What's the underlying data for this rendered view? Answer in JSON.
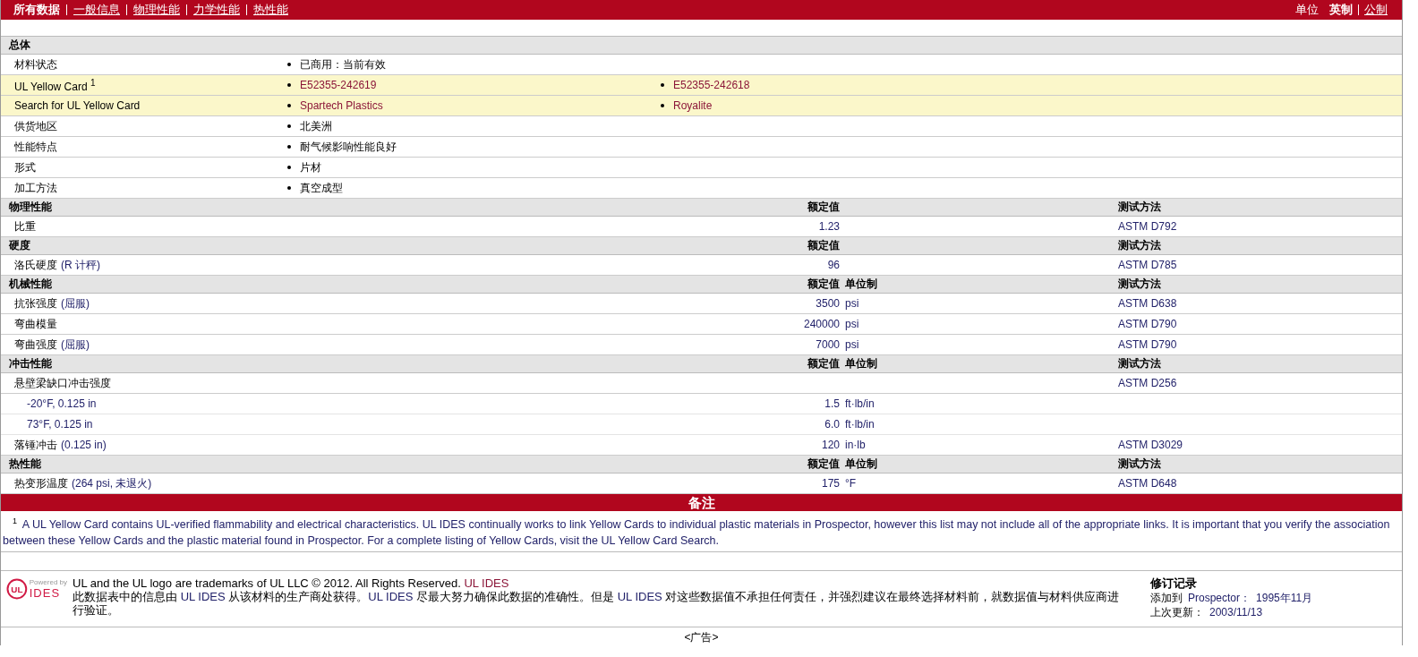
{
  "nav": {
    "items": [
      {
        "label": "所有数据",
        "selected": true
      },
      {
        "label": "一般信息",
        "selected": false
      },
      {
        "label": "物理性能",
        "selected": false
      },
      {
        "label": "力学性能",
        "selected": false
      },
      {
        "label": "热性能",
        "selected": false
      }
    ],
    "units": {
      "label": "单位",
      "options": [
        {
          "label": "英制",
          "selected": true
        },
        {
          "label": "公制",
          "selected": false
        }
      ]
    }
  },
  "general": {
    "title": "总体",
    "rows": [
      {
        "label": "材料状态",
        "highlighted": false,
        "values": [
          {
            "text": "已商用：当前有效",
            "kind": "text"
          }
        ]
      },
      {
        "label": "UL Yellow Card $^{1}$",
        "highlighted": true,
        "values": [
          {
            "text": "E52355-242619",
            "kind": "link"
          },
          {
            "text": "E52355-242618",
            "kind": "link"
          }
        ]
      },
      {
        "label": "Search for UL Yellow Card",
        "highlighted": true,
        "values": [
          {
            "text": "Spartech Plastics",
            "kind": "link"
          },
          {
            "text": "Royalite",
            "kind": "link"
          }
        ]
      },
      {
        "label": "供货地区",
        "highlighted": false,
        "values": [
          {
            "text": "北美洲",
            "kind": "text"
          }
        ]
      },
      {
        "label": "性能特点",
        "highlighted": false,
        "values": [
          {
            "text": "耐气候影响性能良好",
            "kind": "text"
          }
        ]
      },
      {
        "label": "形式",
        "highlighted": false,
        "values": [
          {
            "text": "片材",
            "kind": "text"
          }
        ]
      },
      {
        "label": "加工方法",
        "highlighted": false,
        "values": [
          {
            "text": "真空成型",
            "kind": "text"
          }
        ]
      }
    ]
  },
  "sections": [
    {
      "title": "物理性能",
      "header": {
        "value": "额定值",
        "method": "测试方法"
      },
      "rows": [
        {
          "label": "比重",
          "value": "1.23",
          "method": "ASTM D792"
        }
      ]
    },
    {
      "title": "硬度",
      "header": {
        "value": "额定值",
        "method": "测试方法"
      },
      "rows": [
        {
          "label": "洛氏硬度",
          "qualifier": "(R 计秤)",
          "value": "96",
          "method": "ASTM D785"
        }
      ]
    },
    {
      "title": "机械性能",
      "header": {
        "value": "额定值",
        "unit": "单位制",
        "method": "测试方法"
      },
      "rows": [
        {
          "label": "抗张强度",
          "qualifier": "(屈服)",
          "value": "3500",
          "unit": "psi",
          "method": "ASTM D638"
        },
        {
          "label": "弯曲模量",
          "value": "240000",
          "unit": "psi",
          "method": "ASTM D790"
        },
        {
          "label": "弯曲强度",
          "qualifier": "(屈服)",
          "value": "7000",
          "unit": "psi",
          "method": "ASTM D790"
        }
      ]
    },
    {
      "title": "冲击性能",
      "header": {
        "value": "额定值",
        "unit": "单位制",
        "method": "测试方法"
      },
      "rows": [
        {
          "label": "悬壁梁缺口冲击强度",
          "method": "ASTM D256",
          "children": [
            {
              "label": "-20°F, 0.125 in",
              "value": "1.5",
              "unit": "ft·lb/in"
            },
            {
              "label": "73°F, 0.125 in",
              "value": "6.0",
              "unit": "ft·lb/in"
            }
          ]
        },
        {
          "label": "落锤冲击",
          "qualifier": "(0.125 in)",
          "value": "120",
          "unit": "in·lb",
          "method": "ASTM D3029"
        }
      ]
    },
    {
      "title": "热性能",
      "header": {
        "value": "额定值",
        "unit": "单位制",
        "method": "测试方法"
      },
      "rows": [
        {
          "label": "热变形温度",
          "qualifier": "(264 psi, 未退火)",
          "value": "175",
          "unit": "°F",
          "method": "ASTM D648"
        }
      ]
    }
  ],
  "notes": {
    "title": "备注",
    "text": "$^{1}$ A UL Yellow Card contains UL-verified flammability and electrical characteristics. UL IDES continually works to link Yellow Cards to individual plastic materials in Prospector, however this list may not include all of the appropriate links. It is important that you verify the association between these Yellow Cards and the plastic material found in Prospector. For a complete listing of Yellow Cards, visit the UL Yellow Card Search."
  },
  "footer": {
    "logo": {
      "mark": "UL",
      "caption": "Powered by",
      "brand": "IDES"
    },
    "trademark": [
      {
        "text": "UL and the UL logo are trademarks of UL LLC © 2012. All Rights Reserved. ",
        "kind": "plain"
      },
      {
        "text": "UL IDES",
        "kind": "link"
      }
    ],
    "disclaimer": [
      {
        "text": "此数据表中的信息由 ",
        "kind": "plain"
      },
      {
        "text": "UL IDES",
        "kind": "brand"
      },
      {
        "text": " 从该材料的生产商处获得。",
        "kind": "plain"
      },
      {
        "text": "UL IDES",
        "kind": "brand"
      },
      {
        "text": " 尽最大努力确保此数据的准确性。但是 ",
        "kind": "plain"
      },
      {
        "text": "UL IDES",
        "kind": "brand"
      },
      {
        "text": " 对这些数据值不承担任何责任，并强烈建议在最终选择材料前，就数据值与材料供应商进行验证。",
        "kind": "plain"
      }
    ],
    "revision": {
      "title": "修订记录",
      "rows": [
        {
          "label": "添加到",
          "source": "Prospector：",
          "date": "1995年11月"
        },
        {
          "label": "上次更新：",
          "date": "2003/11/13"
        }
      ]
    }
  },
  "ad_label": "<广告>"
}
